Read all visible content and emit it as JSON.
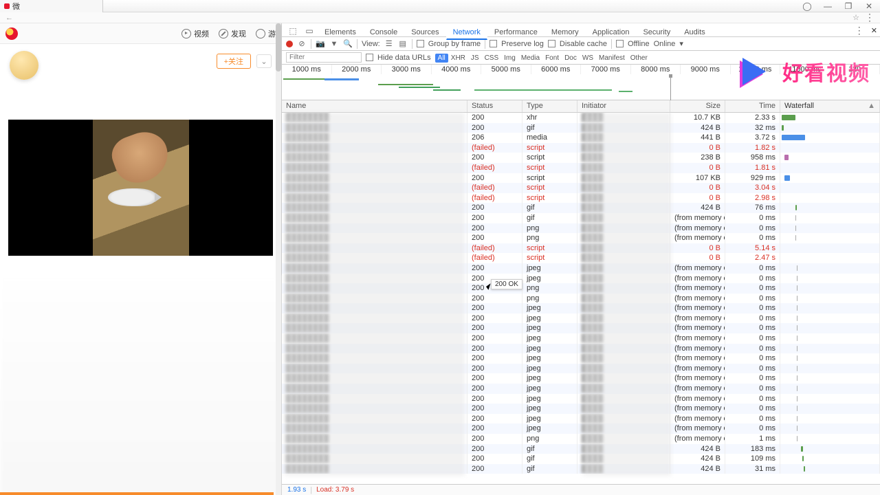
{
  "browser": {
    "tab_title": "微"
  },
  "sysbtn": {
    "acct": "◯",
    "min": "—",
    "max": "❐",
    "close": "✕"
  },
  "weibo": {
    "tab_video": "视频",
    "tab_discover": "发现",
    "tab_game": "游",
    "follow": "+关注"
  },
  "devtools": {
    "tabs": [
      "Elements",
      "Console",
      "Sources",
      "Network",
      "Performance",
      "Memory",
      "Application",
      "Security",
      "Audits"
    ],
    "active_tab": "Network",
    "view_label": "View:",
    "group": "Group by frame",
    "preserve": "Preserve log",
    "disable": "Disable cache",
    "offline": "Offline",
    "throttle": "Online",
    "filter_ph": "Filter",
    "hide": "Hide data URLs",
    "ftypes": [
      "All",
      "XHR",
      "JS",
      "CSS",
      "Img",
      "Media",
      "Font",
      "Doc",
      "WS",
      "Manifest",
      "Other"
    ],
    "timeline_ticks": [
      "1000 ms",
      "2000 ms",
      "3000 ms",
      "4000 ms",
      "5000 ms",
      "6000 ms",
      "7000 ms",
      "8000 ms",
      "9000 ms",
      "10000 ms",
      "11000 ms",
      "120"
    ],
    "cols": {
      "name": "Name",
      "status": "Status",
      "type": "Type",
      "initiator": "Initiator",
      "size": "Size",
      "time": "Time",
      "waterfall": "Waterfall"
    },
    "tooltip": "200 OK",
    "status": {
      "dom": "1.93 s",
      "load": "Load: 3.79 s"
    },
    "rows": [
      {
        "status": "200",
        "type": "xhr",
        "size": "10.7 KB",
        "time": "2.33 s",
        "wf": {
          "l": 2,
          "w": 20,
          "c": "#5b9e4d"
        }
      },
      {
        "status": "200",
        "type": "gif",
        "size": "424 B",
        "time": "32 ms",
        "wf": {
          "l": 2,
          "w": 3,
          "c": "#5b9e4d"
        }
      },
      {
        "status": "206",
        "type": "media",
        "size": "441 B",
        "time": "3.72 s",
        "wf": {
          "l": 2,
          "w": 34,
          "c": "#4a8fe7"
        }
      },
      {
        "status": "(failed)",
        "type": "script",
        "fail": true,
        "size": "0 B",
        "time": "1.82 s"
      },
      {
        "status": "200",
        "type": "script",
        "size": "238 B",
        "time": "958 ms",
        "wf": {
          "l": 6,
          "w": 6,
          "c": "#b96fae"
        }
      },
      {
        "status": "(failed)",
        "type": "script",
        "fail": true,
        "size": "0 B",
        "time": "1.81 s"
      },
      {
        "status": "200",
        "type": "script",
        "size": "107 KB",
        "time": "929 ms",
        "wf": {
          "l": 6,
          "w": 8,
          "c": "#4a8fe7"
        }
      },
      {
        "status": "(failed)",
        "type": "script",
        "fail": true,
        "size": "0 B",
        "time": "3.04 s"
      },
      {
        "status": "(failed)",
        "type": "script",
        "fail": true,
        "size": "0 B",
        "time": "2.98 s"
      },
      {
        "status": "200",
        "type": "gif",
        "size": "424 B",
        "time": "76 ms",
        "wf": {
          "l": 22,
          "w": 2,
          "c": "#5b9e4d"
        }
      },
      {
        "status": "200",
        "type": "gif",
        "size": "(from memory cac…",
        "time": "0 ms",
        "wf": {
          "l": 22,
          "w": 1,
          "c": "#aaa"
        }
      },
      {
        "status": "200",
        "type": "png",
        "size": "(from memory cac…",
        "time": "0 ms",
        "wf": {
          "l": 22,
          "w": 1,
          "c": "#aaa"
        }
      },
      {
        "status": "200",
        "type": "png",
        "size": "(from memory cac…",
        "time": "0 ms",
        "wf": {
          "l": 22,
          "w": 1,
          "c": "#aaa"
        }
      },
      {
        "status": "(failed)",
        "type": "script",
        "fail": true,
        "size": "0 B",
        "time": "5.14 s"
      },
      {
        "status": "(failed)",
        "type": "script",
        "fail": true,
        "size": "0 B",
        "time": "2.47 s"
      },
      {
        "status": "200",
        "type": "jpeg",
        "size": "(from memory cac…",
        "time": "0 ms",
        "wf": {
          "l": 24,
          "w": 1,
          "c": "#aaa"
        }
      },
      {
        "status": "200",
        "type": "jpeg",
        "size": "(from memory cac…",
        "time": "0 ms",
        "wf": {
          "l": 24,
          "w": 1,
          "c": "#aaa"
        }
      },
      {
        "status": "200",
        "type": "png",
        "size": "(from memory cac…",
        "time": "0 ms",
        "wf": {
          "l": 24,
          "w": 1,
          "c": "#aaa"
        }
      },
      {
        "status": "200",
        "type": "png",
        "size": "(from memory cac…",
        "time": "0 ms",
        "wf": {
          "l": 24,
          "w": 1,
          "c": "#aaa"
        }
      },
      {
        "status": "200",
        "type": "jpeg",
        "size": "(from memory cac…",
        "time": "0 ms",
        "wf": {
          "l": 24,
          "w": 1,
          "c": "#aaa"
        }
      },
      {
        "status": "200",
        "type": "jpeg",
        "size": "(from memory cac…",
        "time": "0 ms",
        "wf": {
          "l": 24,
          "w": 1,
          "c": "#aaa"
        }
      },
      {
        "status": "200",
        "type": "jpeg",
        "size": "(from memory cac…",
        "time": "0 ms",
        "wf": {
          "l": 24,
          "w": 1,
          "c": "#aaa"
        }
      },
      {
        "status": "200",
        "type": "jpeg",
        "size": "(from memory cac…",
        "time": "0 ms",
        "wf": {
          "l": 24,
          "w": 1,
          "c": "#aaa"
        }
      },
      {
        "status": "200",
        "type": "jpeg",
        "size": "(from memory cac…",
        "time": "0 ms",
        "wf": {
          "l": 24,
          "w": 1,
          "c": "#aaa"
        }
      },
      {
        "status": "200",
        "type": "jpeg",
        "size": "(from memory cac…",
        "time": "0 ms",
        "wf": {
          "l": 24,
          "w": 1,
          "c": "#aaa"
        }
      },
      {
        "status": "200",
        "type": "jpeg",
        "size": "(from memory cac…",
        "time": "0 ms",
        "wf": {
          "l": 24,
          "w": 1,
          "c": "#aaa"
        }
      },
      {
        "status": "200",
        "type": "jpeg",
        "size": "(from memory cac…",
        "time": "0 ms",
        "wf": {
          "l": 24,
          "w": 1,
          "c": "#aaa"
        }
      },
      {
        "status": "200",
        "type": "jpeg",
        "size": "(from memory cac…",
        "time": "0 ms",
        "wf": {
          "l": 24,
          "w": 1,
          "c": "#aaa"
        }
      },
      {
        "status": "200",
        "type": "jpeg",
        "size": "(from memory cac…",
        "time": "0 ms",
        "wf": {
          "l": 24,
          "w": 1,
          "c": "#aaa"
        }
      },
      {
        "status": "200",
        "type": "jpeg",
        "size": "(from memory cac…",
        "time": "0 ms",
        "wf": {
          "l": 24,
          "w": 1,
          "c": "#aaa"
        }
      },
      {
        "status": "200",
        "type": "jpeg",
        "size": "(from memory cac…",
        "time": "0 ms",
        "wf": {
          "l": 24,
          "w": 1,
          "c": "#aaa"
        }
      },
      {
        "status": "200",
        "type": "jpeg",
        "size": "(from memory cac…",
        "time": "0 ms",
        "wf": {
          "l": 24,
          "w": 1,
          "c": "#aaa"
        }
      },
      {
        "status": "200",
        "type": "png",
        "size": "(from memory cac…",
        "time": "1 ms",
        "wf": {
          "l": 24,
          "w": 1,
          "c": "#aaa"
        }
      },
      {
        "status": "200",
        "type": "gif",
        "size": "424 B",
        "time": "183 ms",
        "wf": {
          "l": 30,
          "w": 3,
          "c": "#5b9e4d"
        }
      },
      {
        "status": "200",
        "type": "gif",
        "size": "424 B",
        "time": "109 ms",
        "wf": {
          "l": 32,
          "w": 2,
          "c": "#5b9e4d"
        }
      },
      {
        "status": "200",
        "type": "gif",
        "size": "424 B",
        "time": "31 ms",
        "wf": {
          "l": 34,
          "w": 2,
          "c": "#5b9e4d"
        }
      }
    ]
  },
  "brand": "好看视频"
}
